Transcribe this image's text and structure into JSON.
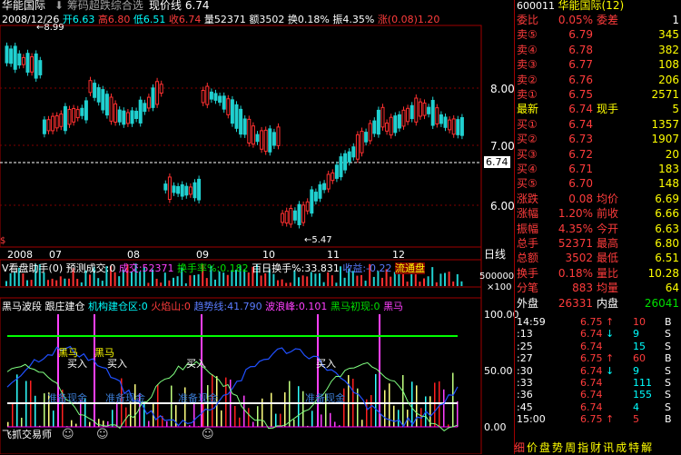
{
  "stock": {
    "name": "华能国际",
    "title_filter": "筹码超跌综合选",
    "price_now": "现价线 6.74",
    "code": "600011",
    "right_name": "华能国际(12)"
  },
  "quote_bar": {
    "date": "2008/12/26",
    "open": "开6.63",
    "high": "高6.80",
    "low": "低6.51",
    "close": "收6.74",
    "vol": "量52371",
    "amt": "额3502",
    "chg": "换0.18%",
    "amp": "振4.35%",
    "zf": "涨(0.08)1.20"
  },
  "price_axis": [
    "8.00",
    "7.00",
    "6.74",
    "6.00"
  ],
  "annotations": {
    "max": "8.99",
    "min": "5.47"
  },
  "date_axis": {
    "labels": [
      "2008",
      "07",
      "08",
      "09",
      "10",
      "11",
      "12"
    ],
    "period": "日线"
  },
  "volume_bar": {
    "title": "V看盘助手(0)",
    "pred": "预测成交:0",
    "vol": "成交:52371",
    "turn": "换手率%:0.182",
    "avg": "百日换手%:33.831",
    "income": "收益:-0.22",
    "flow": "流通盘"
  },
  "vol_axis": [
    "500000",
    "×100"
  ],
  "ind_bar": {
    "a": "黑马波段",
    "b": "跟庄建仓",
    "c": "机构建仓区:0",
    "d": "火焰山:0",
    "e": "趋势线:41.790",
    "f": "波浪峰:0.101",
    "g": "黑马初现:0",
    "h": "黑马"
  },
  "ind_axis": [
    "100.00",
    "50.00",
    "0.00"
  ],
  "ind_labels": {
    "hm": "黑马",
    "buy": "买入",
    "zj": "准备现金",
    "fei": "飞抓交易师"
  },
  "book": {
    "wb": [
      "委比",
      "0.05%",
      "委差",
      "1"
    ],
    "sells": [
      [
        "卖⑤",
        "6.79",
        "345"
      ],
      [
        "卖④",
        "6.78",
        "382"
      ],
      [
        "卖③",
        "6.77",
        "108"
      ],
      [
        "卖②",
        "6.76",
        "206"
      ],
      [
        "卖①",
        "6.75",
        "2571"
      ]
    ],
    "last": [
      "最新",
      "6.74",
      "现手",
      "5"
    ],
    "buys": [
      [
        "买①",
        "6.74",
        "1357"
      ],
      [
        "买②",
        "6.73",
        "1907"
      ],
      [
        "买③",
        "6.72",
        "20"
      ],
      [
        "买④",
        "6.71",
        "183"
      ],
      [
        "买⑤",
        "6.70",
        "148"
      ]
    ],
    "stats": [
      [
        "涨跌",
        "0.08",
        "均价",
        "6.69"
      ],
      [
        "涨幅",
        "1.20%",
        "前收",
        "6.66"
      ],
      [
        "振幅",
        "4.35%",
        "今开",
        "6.63"
      ],
      [
        "总手",
        "52371",
        "最高",
        "6.80"
      ],
      [
        "总额",
        "3502",
        "最低",
        "6.51"
      ],
      [
        "换手",
        "0.18%",
        "量比",
        "10.28"
      ],
      [
        "分笔",
        "883",
        "均量",
        "64"
      ]
    ],
    "outer": [
      "外盘",
      "26331",
      "内盘",
      "26041"
    ]
  },
  "ticks": [
    [
      "14:59",
      "6.75",
      "↑",
      "10",
      "B"
    ],
    [
      ":13",
      "6.74",
      "↓",
      "9",
      "S"
    ],
    [
      ":25",
      "6.74",
      "",
      "15",
      "S"
    ],
    [
      ":27",
      "6.75",
      "↑",
      "60",
      "B"
    ],
    [
      ":30",
      "6.74",
      "↓",
      "9",
      "S"
    ],
    [
      ":33",
      "6.74",
      "",
      "111",
      "S"
    ],
    [
      ":36",
      "6.74",
      "",
      "155",
      "S"
    ],
    [
      ":45",
      "6.74",
      "",
      "4",
      "S"
    ],
    [
      "15:00",
      "6.75",
      "↑",
      "5",
      "B"
    ]
  ],
  "footer": [
    "细",
    "价",
    "盘",
    "势",
    "周",
    "指",
    "财",
    "讯",
    "成",
    "特",
    "解"
  ]
}
